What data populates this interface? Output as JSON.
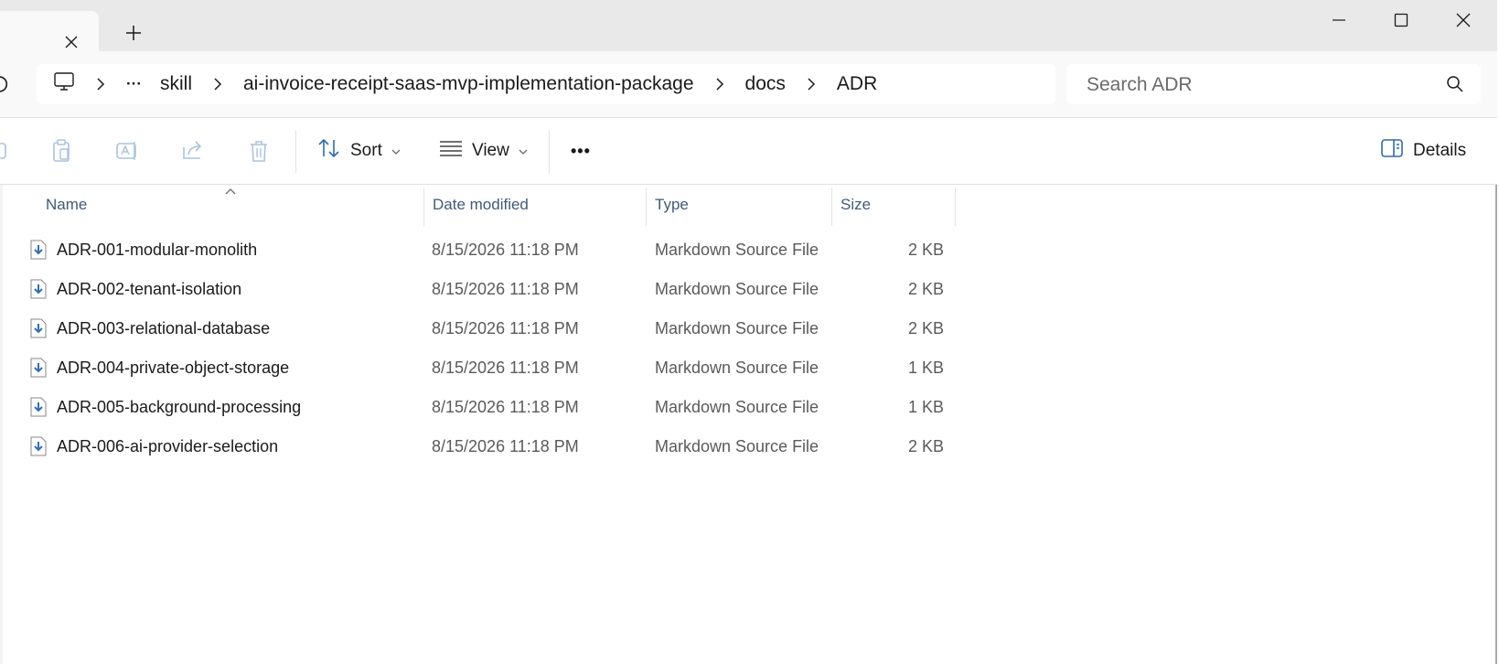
{
  "window": {
    "new_tab_label": "+",
    "controls": [
      "minimize",
      "maximize",
      "close"
    ]
  },
  "address": {
    "breadcrumb": [
      {
        "kind": "icon",
        "icon": "this-pc-icon"
      },
      {
        "kind": "overflow",
        "label": "···"
      },
      {
        "kind": "folder",
        "label": "skill"
      },
      {
        "kind": "folder",
        "label": "ai-invoice-receipt-saas-mvp-implementation-package"
      },
      {
        "kind": "folder",
        "label": "docs"
      },
      {
        "kind": "folder",
        "label": "ADR"
      }
    ],
    "search_placeholder": "Search ADR"
  },
  "toolbar": {
    "icons": [
      "new-icon",
      "paste-icon",
      "rename-icon",
      "share-icon",
      "delete-icon"
    ],
    "sort_label": "Sort",
    "view_label": "View",
    "more_label": "•••",
    "details_label": "Details"
  },
  "columns": {
    "name": "Name",
    "date": "Date modified",
    "type": "Type",
    "size": "Size"
  },
  "files": [
    {
      "name": "ADR-001-modular-monolith",
      "date": "8/15/2026 11:18 PM",
      "type": "Markdown Source File",
      "size": "2 KB"
    },
    {
      "name": "ADR-002-tenant-isolation",
      "date": "8/15/2026 11:18 PM",
      "type": "Markdown Source File",
      "size": "2 KB"
    },
    {
      "name": "ADR-003-relational-database",
      "date": "8/15/2026 11:18 PM",
      "type": "Markdown Source File",
      "size": "2 KB"
    },
    {
      "name": "ADR-004-private-object-storage",
      "date": "8/15/2026 11:18 PM",
      "type": "Markdown Source File",
      "size": "1 KB"
    },
    {
      "name": "ADR-005-background-processing",
      "date": "8/15/2026 11:18 PM",
      "type": "Markdown Source File",
      "size": "1 KB"
    },
    {
      "name": "ADR-006-ai-provider-selection",
      "date": "8/15/2026 11:18 PM",
      "type": "Markdown Source File",
      "size": "2 KB"
    }
  ],
  "colors": {
    "accent": "#2b6cb0",
    "header_text": "#3f5b78",
    "file_icon": "#2f6fb3"
  }
}
